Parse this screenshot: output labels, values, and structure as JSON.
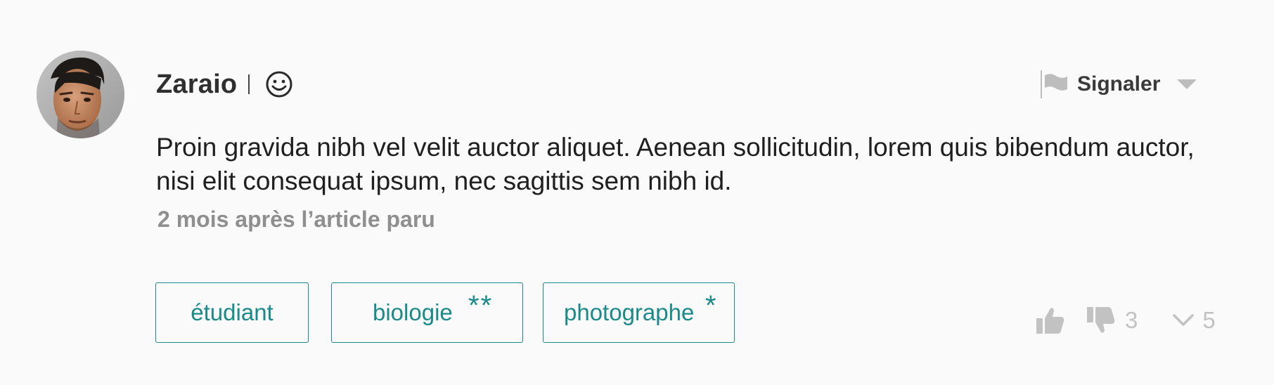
{
  "comment": {
    "author": {
      "name": "Zaraio",
      "badge_icon": "smiley-icon",
      "avatar_icon": "user-avatar-photo"
    },
    "report": {
      "label": "Signaler",
      "icon": "flag-icon",
      "dropdown_icon": "chevron-down-icon"
    },
    "body": "Proin gravida nibh vel velit auctor aliquet. Aenean sollicitudin, lorem quis bibendum auctor, nisi elit consequat ipsum, nec sagittis sem nibh id.",
    "meta": "2 mois après l’article paru",
    "tags": [
      {
        "label": "étudiant",
        "stars": ""
      },
      {
        "label": "biologie",
        "stars": "**"
      },
      {
        "label": "photographe",
        "stars": "*"
      }
    ],
    "votes": {
      "like_icon": "thumbs-up-icon",
      "dislike_icon": "thumbs-down-icon",
      "dislike_count": "3",
      "replies_icon": "chevron-down-icon",
      "reply_count": "5"
    },
    "colors": {
      "accent": "#1a8a8a",
      "muted": "#c2c2c2",
      "meta_text": "#8f8f8f",
      "background": "#fafafa"
    }
  }
}
